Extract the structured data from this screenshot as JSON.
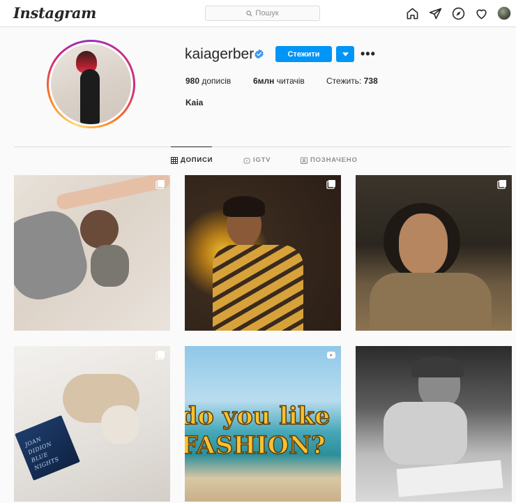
{
  "nav": {
    "logo": "Instagram",
    "search_placeholder": "Пошук",
    "icons": [
      "home-icon",
      "direct-icon",
      "explore-icon",
      "activity-icon",
      "profile-avatar"
    ]
  },
  "profile": {
    "username": "kaiagerber",
    "verified": true,
    "follow_label": "Стежити",
    "posts_count": "980",
    "posts_label": "дописів",
    "followers_count": "6млн",
    "followers_label": "читачів",
    "following_label": "Стежить:",
    "following_count": "738",
    "full_name": "Kaia"
  },
  "tabs": [
    {
      "label": "ДОПИСИ",
      "icon": "grid-icon",
      "active": true
    },
    {
      "label": "IGTV",
      "icon": "igtv-icon",
      "active": false
    },
    {
      "label": "ПОЗНАЧЕНО",
      "icon": "tagged-icon",
      "active": false
    }
  ],
  "posts": [
    {
      "id": "post-1",
      "multi": true
    },
    {
      "id": "post-2",
      "multi": true
    },
    {
      "id": "post-3",
      "multi": true
    },
    {
      "id": "post-4",
      "multi": true
    },
    {
      "id": "post-5",
      "multi": false,
      "overlay_text": [
        "do you like",
        "FASHION?"
      ]
    },
    {
      "id": "post-6",
      "multi": false
    }
  ],
  "colors": {
    "accent": "#0095f6",
    "text": "#262626",
    "muted": "#8e8e8e",
    "border": "#dbdbdb"
  }
}
